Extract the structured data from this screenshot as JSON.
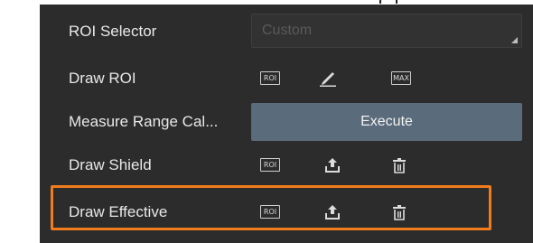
{
  "rows": [
    {
      "label": "ROI Selector",
      "select_value": "Custom"
    },
    {
      "label": "Draw ROI",
      "icons": [
        "ROI",
        "pencil-icon",
        "MAX"
      ]
    },
    {
      "label": "Measure Range Cal...",
      "button": "Execute"
    },
    {
      "label": "Draw Shield",
      "icons": [
        "ROI",
        "upload-icon",
        "trash-icon"
      ]
    },
    {
      "label": "Draw Effective",
      "icons": [
        "ROI",
        "upload-icon",
        "trash-icon"
      ]
    }
  ],
  "colors": {
    "panel_bg": "#2c2c2c",
    "button_bg": "#5a6b7c",
    "highlight": "#f07c1e"
  },
  "highlighted_row": "Draw Effective"
}
